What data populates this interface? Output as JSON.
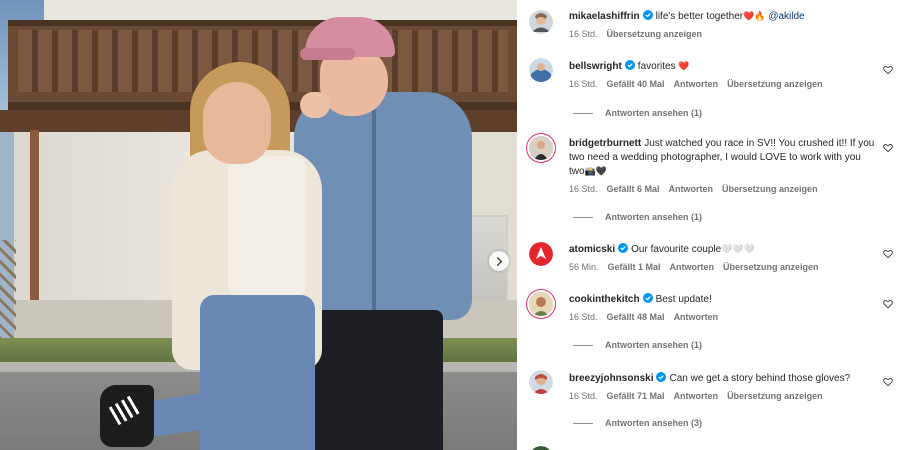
{
  "photo": {
    "carousel_next_icon": "chevron-right-icon"
  },
  "comments": [
    {
      "username": "mikaelashiffrin",
      "verified": true,
      "text": "life's better together",
      "emoji": "❤️🔥",
      "mention": "@akilde",
      "time": "16 Std.",
      "likes": "",
      "reply": "",
      "translate": "Übersetzung anzeigen",
      "show_replies": ""
    },
    {
      "username": "bellswright",
      "verified": true,
      "text": "favorites",
      "emoji": "❤️",
      "time": "16 Std.",
      "likes": "Gefällt 40 Mal",
      "reply": "Antworten",
      "translate": "Übersetzung anzeigen",
      "show_replies": "Antworten ansehen (1)"
    },
    {
      "username": "bridgetrburnett",
      "verified": false,
      "text": "Just watched you race in SV!! You crushed it!! If you two need a wedding photographer, I would LOVE to work with you two",
      "emoji": "📸🖤",
      "time": "16 Std.",
      "likes": "Gefällt 6 Mal",
      "reply": "Antworten",
      "translate": "Übersetzung anzeigen",
      "show_replies": "Antworten ansehen (1)"
    },
    {
      "username": "atomicski",
      "verified": true,
      "text": "Our favourite couple",
      "emoji": "🤍🤍🤍",
      "time": "56 Min.",
      "likes": "Gefällt 1 Mal",
      "reply": "Antworten",
      "translate": "Übersetzung anzeigen",
      "show_replies": ""
    },
    {
      "username": "cookinthekitch",
      "verified": true,
      "text": "Best update!",
      "emoji": "",
      "time": "16 Std.",
      "likes": "Gefällt 48 Mal",
      "reply": "Antworten",
      "translate": "",
      "show_replies": "Antworten ansehen (1)"
    },
    {
      "username": "breezyjohnsonski",
      "verified": true,
      "text": "Can we get a story behind those gloves?",
      "emoji": "",
      "time": "16 Std.",
      "likes": "Gefällt 71 Mal",
      "reply": "Antworten",
      "translate": "Übersetzung anzeigen",
      "show_replies": "Antworten ansehen (3)"
    }
  ],
  "colors": {
    "verified": "#0095f6",
    "heart_red": "#ed4956",
    "meta_gray": "#737373",
    "atomic_red": "#e3262e"
  },
  "icons": {
    "verified": "verified-badge-icon",
    "like": "heart-outline-icon"
  }
}
